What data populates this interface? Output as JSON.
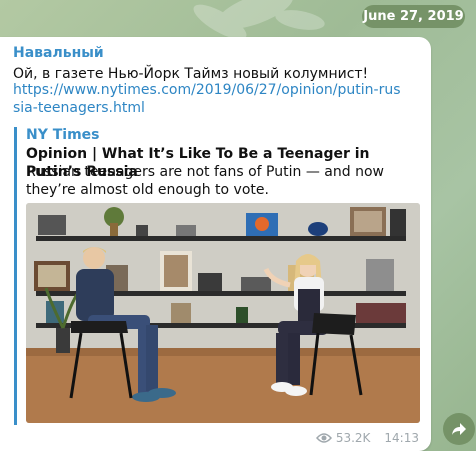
{
  "date_pill": "June 27, 2019",
  "message": {
    "sender": "Навальный",
    "text": "Ой, в газете Нью-Йорк Таймз новый колумнист!",
    "link": "https://www.nytimes.com/2019/06/27/opinion/putin-russia-teenagers.html"
  },
  "preview": {
    "site_name": "NY Times",
    "title": "Opinion | What It’s Like To Be a Teenager in Putin’s Russia",
    "description": "Russian teenagers are not fans of Putin — and now they’re almost old enough to vote."
  },
  "meta": {
    "views": "53.2K",
    "time": "14:13"
  },
  "icons": {
    "views": "eye-icon",
    "share": "share-arrow-icon"
  },
  "colors": {
    "accent": "#3a8fc9",
    "link": "#2e86c4",
    "pill": "#6e8c5f"
  }
}
